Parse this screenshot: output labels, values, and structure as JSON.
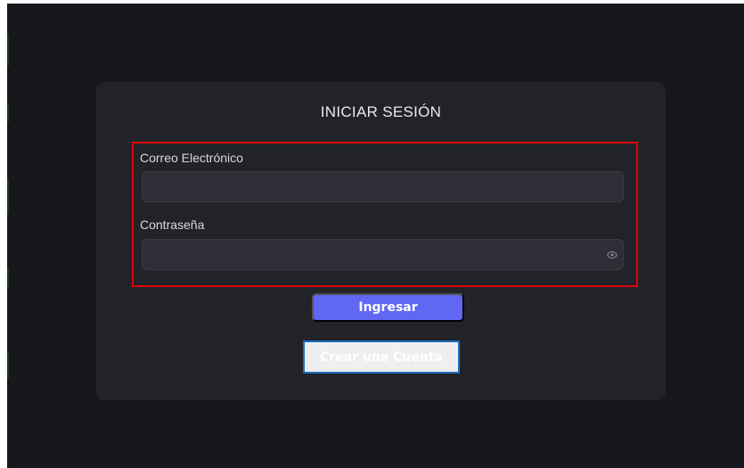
{
  "login": {
    "title": "INICIAR SESIÓN",
    "email_label": "Correo Electrónico",
    "email_value": "",
    "password_label": "Contraseña",
    "password_value": "",
    "submit_label": "Ingresar",
    "create_account_label": "Crear una Cuenta"
  },
  "icons": {
    "password_toggle": "eye-icon"
  },
  "colors": {
    "background": "#17181d",
    "card": "#222329",
    "input": "#2d2e36",
    "primary_button": "#6067f3",
    "highlight_border": "#e0000b",
    "outline_button_border": "#1f71bf"
  }
}
